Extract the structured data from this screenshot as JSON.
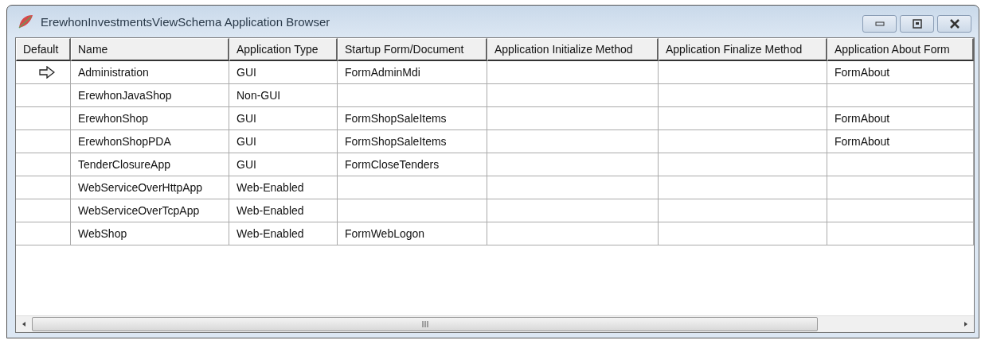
{
  "window": {
    "title": "ErewhonInvestmentsViewSchema Application Browser"
  },
  "table": {
    "columns": [
      "Default",
      "Name",
      "Application Type",
      "Startup Form/Document",
      "Application Initialize Method",
      "Application Finalize Method",
      "Application About Form"
    ],
    "rows": [
      {
        "default": true,
        "name": "Administration",
        "type": "GUI",
        "startup": "FormAdminMdi",
        "about": "FormAbout"
      },
      {
        "default": false,
        "name": "ErewhonJavaShop",
        "type": "Non-GUI"
      },
      {
        "default": false,
        "name": "ErewhonShop",
        "type": "GUI",
        "startup": "FormShopSaleItems",
        "about": "FormAbout"
      },
      {
        "default": false,
        "name": "ErewhonShopPDA",
        "type": "GUI",
        "startup": "FormShopSaleItems",
        "about": "FormAbout"
      },
      {
        "default": false,
        "name": "TenderClosureApp",
        "type": "GUI",
        "startup": "FormCloseTenders"
      },
      {
        "default": false,
        "name": "WebServiceOverHttpApp",
        "type": "Web-Enabled"
      },
      {
        "default": false,
        "name": "WebServiceOverTcpApp",
        "type": "Web-Enabled"
      },
      {
        "default": false,
        "name": "WebShop",
        "type": "Web-Enabled",
        "startup": "FormWebLogon"
      }
    ]
  }
}
